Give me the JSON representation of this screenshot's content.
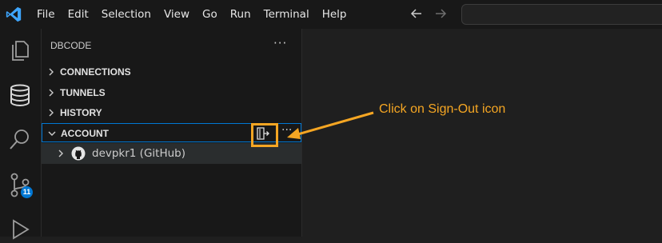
{
  "menu": [
    "File",
    "Edit",
    "Selection",
    "View",
    "Go",
    "Run",
    "Terminal",
    "Help"
  ],
  "activity_bar": {
    "icons": [
      "explorer-icon",
      "database-icon",
      "search-icon",
      "source-control-icon",
      "run-debug-icon"
    ],
    "source_control_badge": "11"
  },
  "sidebar": {
    "title": "DBCODE",
    "more": "···",
    "sections": [
      {
        "label": "CONNECTIONS",
        "expanded": false
      },
      {
        "label": "TUNNELS",
        "expanded": false
      },
      {
        "label": "HISTORY",
        "expanded": false
      },
      {
        "label": "ACCOUNT",
        "expanded": true
      }
    ],
    "section_more": "···",
    "account_item": "devpkr1 (GitHub)"
  },
  "annotation": {
    "text": "Click on Sign-Out icon",
    "color": "#f5a623"
  },
  "colors": {
    "accent": "#0078d4",
    "vscode_blue": "#3ea6ff"
  }
}
